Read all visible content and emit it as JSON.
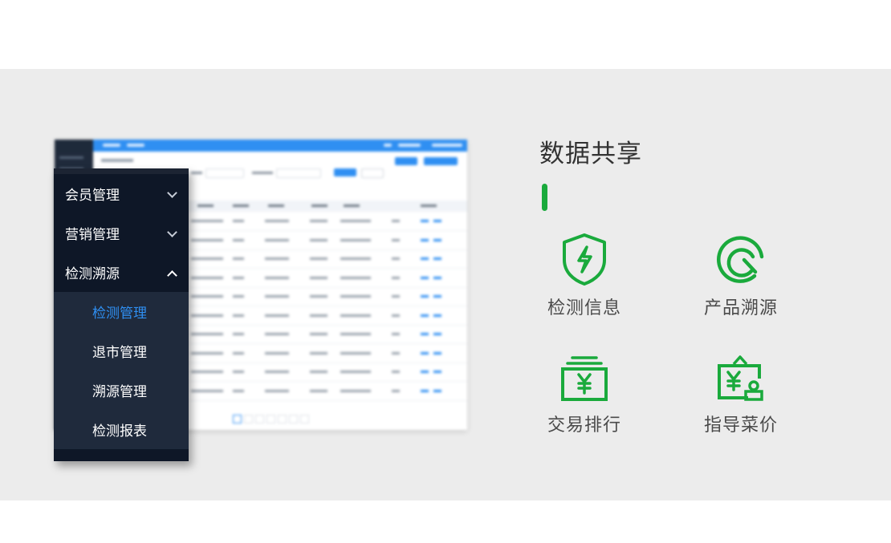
{
  "menu": {
    "items": [
      {
        "label": "会员管理",
        "expanded": false
      },
      {
        "label": "营销管理",
        "expanded": false
      },
      {
        "label": "检测溯源",
        "expanded": true
      }
    ],
    "subitems": [
      {
        "label": "检测管理",
        "active": true
      },
      {
        "label": "退市管理",
        "active": false
      },
      {
        "label": "溯源管理",
        "active": false
      },
      {
        "label": "检测报表",
        "active": false
      }
    ]
  },
  "section": {
    "title": "数据共享",
    "features": [
      {
        "label": "检测信息",
        "icon": "shield-bolt-icon"
      },
      {
        "label": "产品溯源",
        "icon": "trace-refresh-icon"
      },
      {
        "label": "交易排行",
        "icon": "cash-stack-icon"
      },
      {
        "label": "指导菜价",
        "icon": "price-bag-icon"
      }
    ]
  },
  "colors": {
    "accent_green": "#1aaa3c",
    "menu_dark": "#0e1727",
    "menu_sub": "#1f2a3c",
    "link_blue": "#2f8ff2",
    "band_bg": "#ececec"
  }
}
